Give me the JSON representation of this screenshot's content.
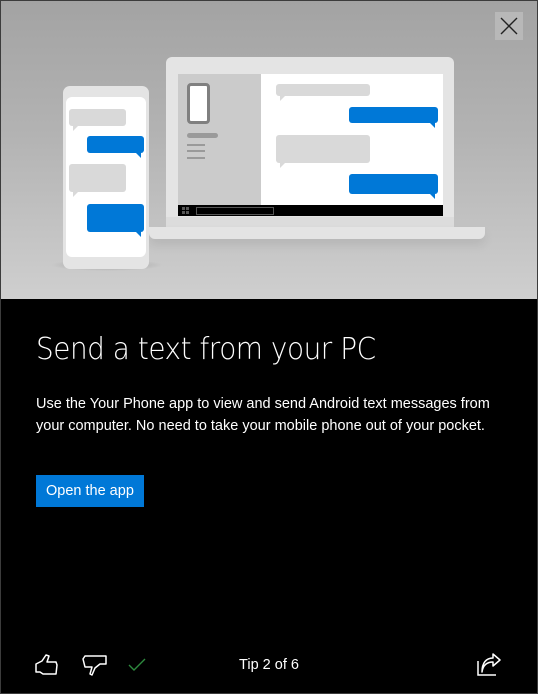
{
  "dialog": {
    "close_label": "Close",
    "title": "Send a text from your PC",
    "description": "Use the Your Phone app to view and send Android text messages from your computer. No need to take your mobile phone out of your pocket.",
    "primary_action": "Open the app"
  },
  "footer": {
    "tip_counter": "Tip 2 of 6",
    "icons": {
      "like": "thumbs-up-icon",
      "dislike": "thumbs-down-icon",
      "feedback_sent": "checkmark-icon",
      "share": "share-icon"
    }
  },
  "colors": {
    "accent": "#0078d7",
    "check": "#2d8a3e",
    "hero_background": "#b3b3b3",
    "content_background": "#000000"
  }
}
